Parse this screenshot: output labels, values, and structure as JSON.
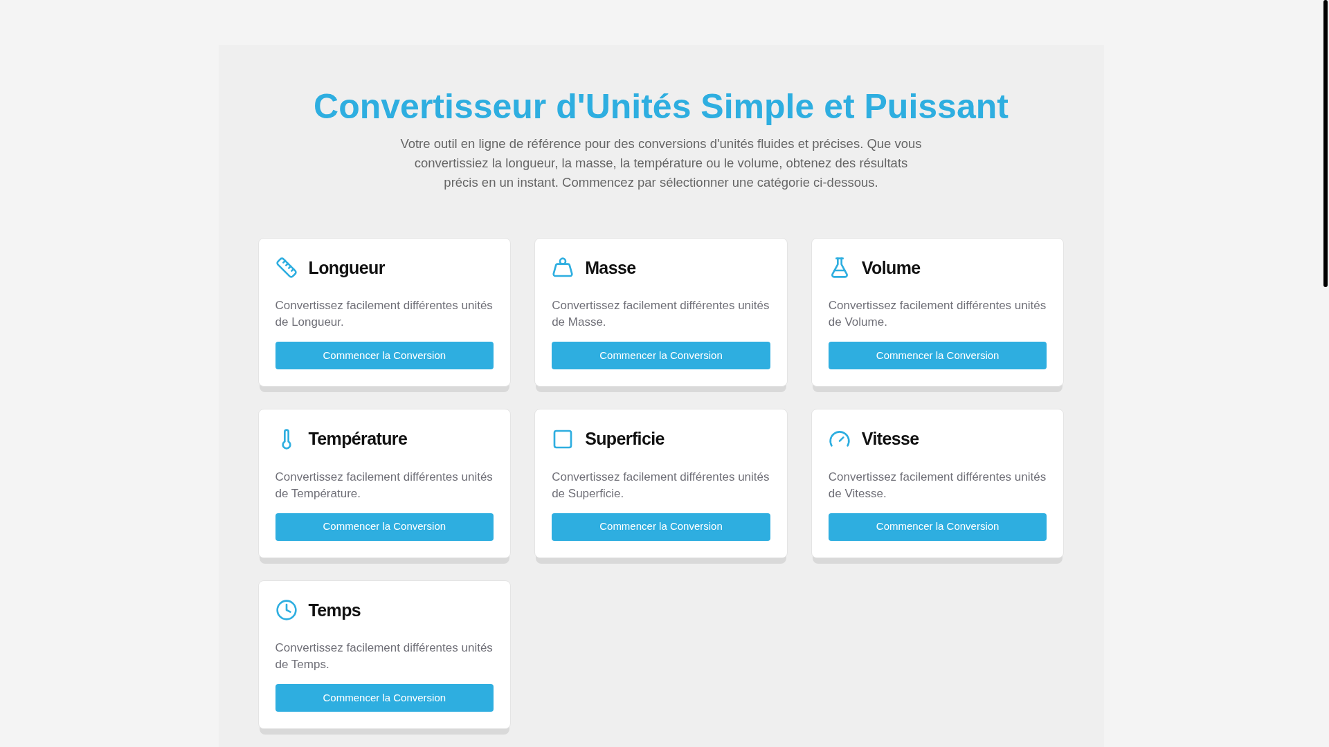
{
  "header": {
    "title": "Convertisseur d'Unités Simple et Puissant",
    "intro": "Votre outil en ligne de référence pour des conversions d'unités fluides et précises. Que vous convertissiez la longueur, la masse, la température ou le volume, obtenez des résultats précis en un instant. Commencez par sélectionner une catégorie ci-dessous."
  },
  "categories": [
    {
      "kind": "length",
      "title": "Longueur",
      "description": "Convertissez facilement différentes unités de Longueur.",
      "button": "Commencer la Conversion"
    },
    {
      "kind": "mass",
      "title": "Masse",
      "description": "Convertissez facilement différentes unités de Masse.",
      "button": "Commencer la Conversion"
    },
    {
      "kind": "volume",
      "title": "Volume",
      "description": "Convertissez facilement différentes unités de Volume.",
      "button": "Commencer la Conversion"
    },
    {
      "kind": "temperature",
      "title": "Température",
      "description": "Convertissez facilement différentes unités de Température.",
      "button": "Commencer la Conversion"
    },
    {
      "kind": "area",
      "title": "Superficie",
      "description": "Convertissez facilement différentes unités de Superficie.",
      "button": "Commencer la Conversion"
    },
    {
      "kind": "speed",
      "title": "Vitesse",
      "description": "Convertissez facilement différentes unités de Vitesse.",
      "button": "Commencer la Conversion"
    },
    {
      "kind": "time",
      "title": "Temps",
      "description": "Convertissez facilement différentes unités de Temps.",
      "button": "Commencer la Conversion"
    }
  ]
}
